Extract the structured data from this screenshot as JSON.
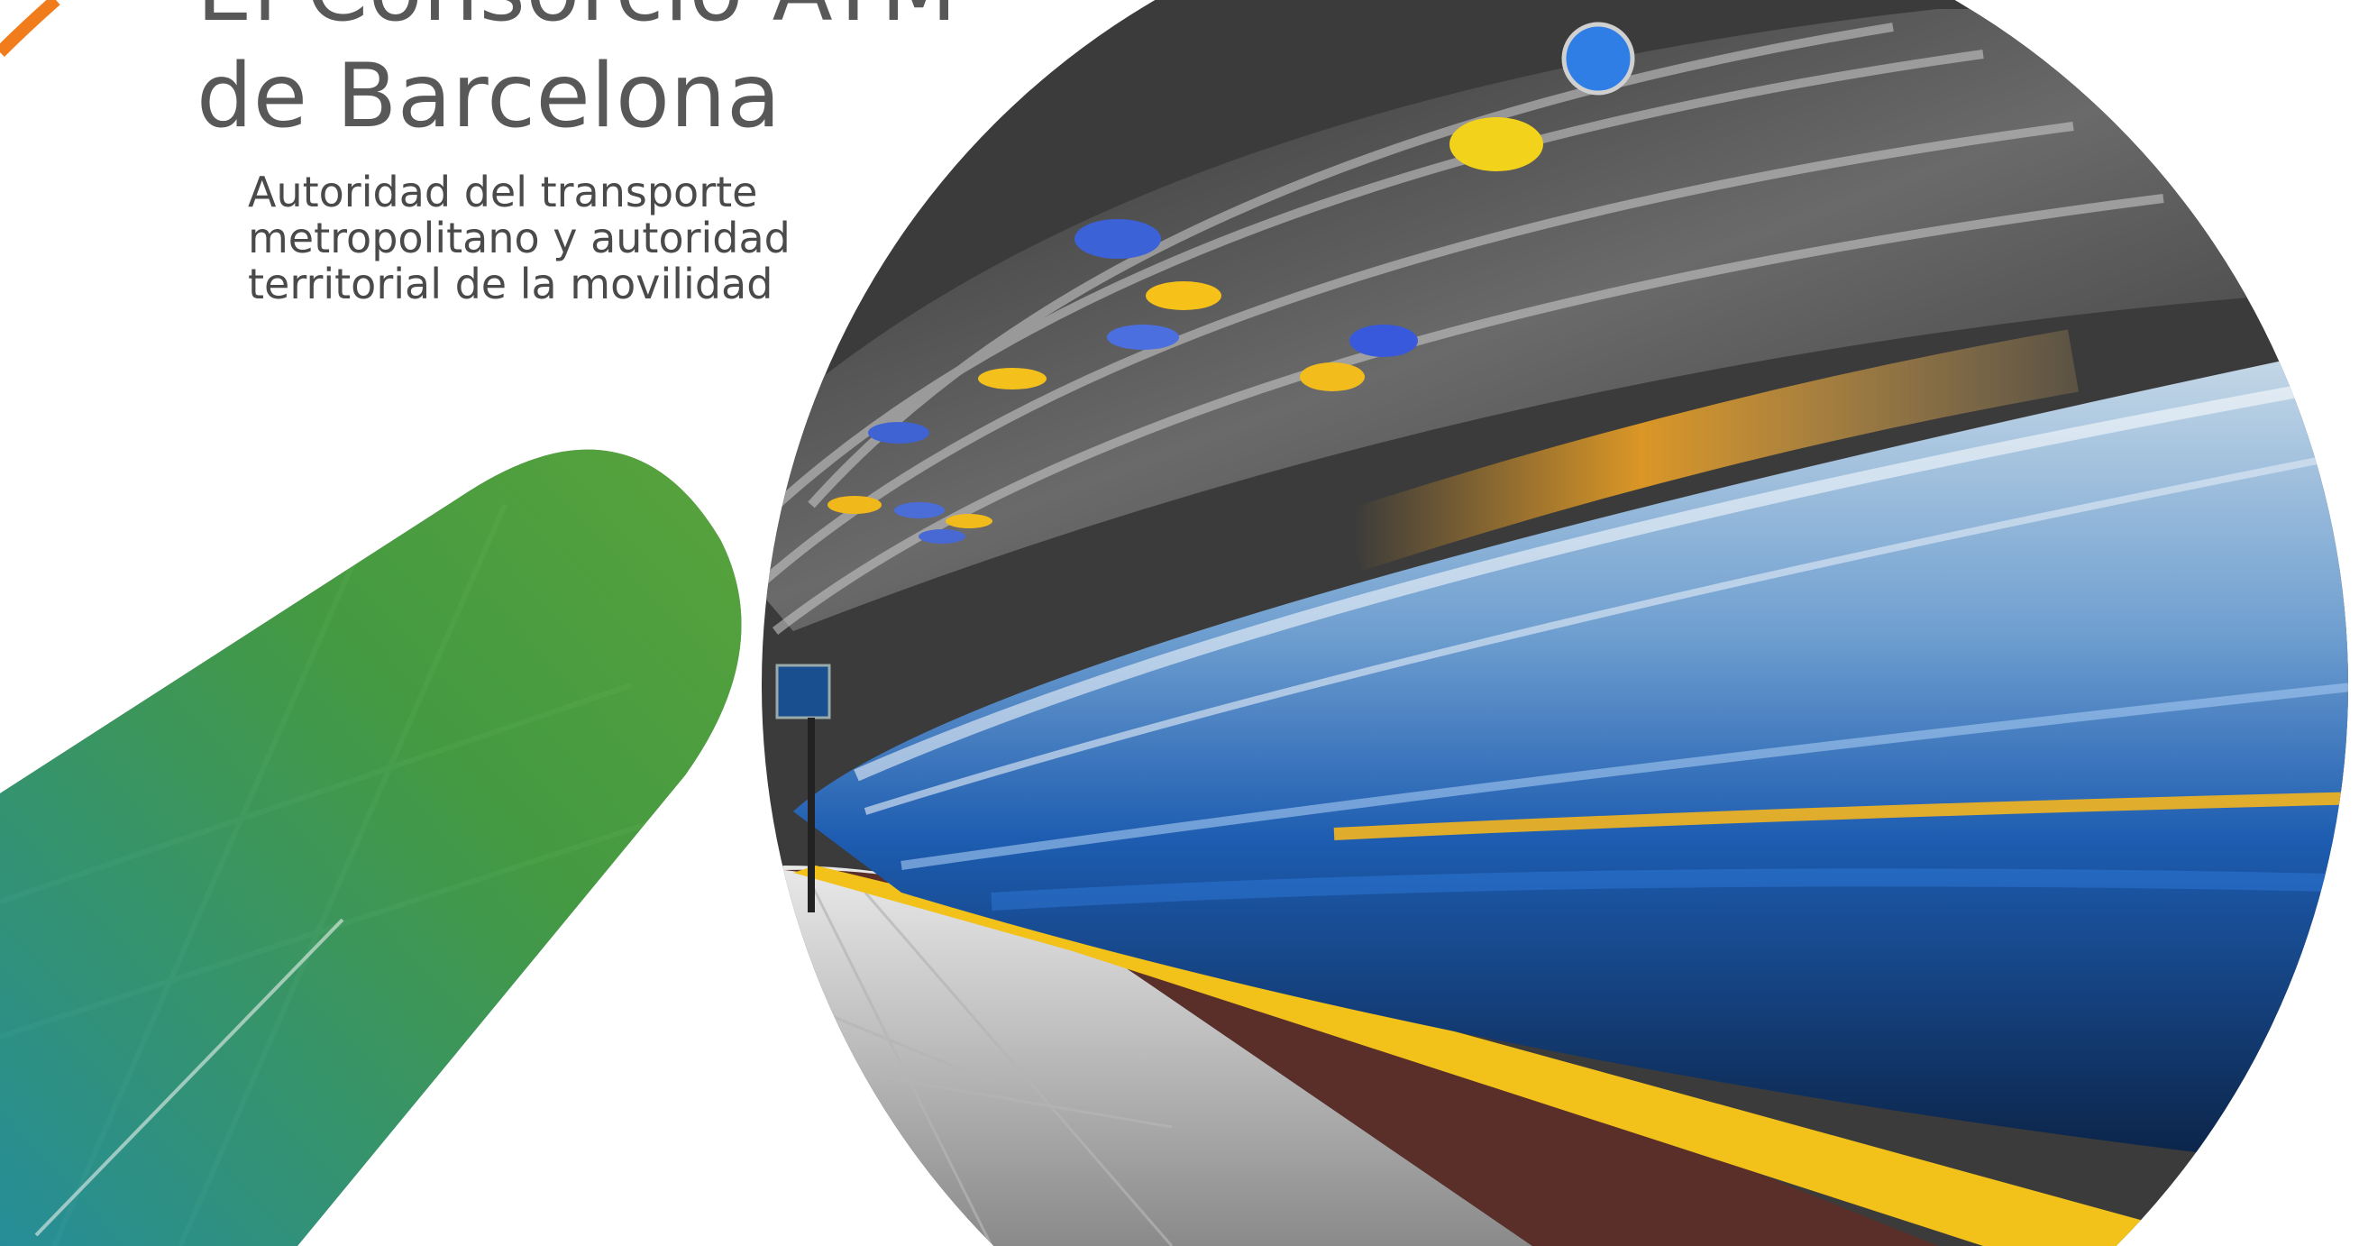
{
  "heading": {
    "line1": "El Consorcio ATM",
    "line2": "de Barcelona"
  },
  "subheading": {
    "line1": "Autoridad del transporte",
    "line2": "metropolitano y autoridad",
    "line3": "territorial de la movilidad"
  },
  "colors": {
    "accent_orange": "#f07c1b",
    "title_gray": "#585858",
    "overlay_green": "#3e9b3a",
    "overlay_teal": "#1f8d9a",
    "platform_stripe": "#f2c21a"
  },
  "image": {
    "subject": "metro-station-photo",
    "overlay": "green-teal-gradient-pill"
  }
}
